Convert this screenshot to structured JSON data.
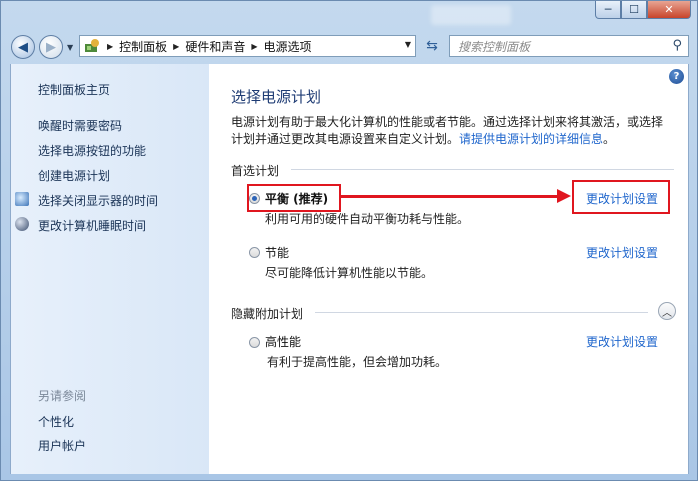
{
  "window": {
    "minimize": "─",
    "maximize": "☐",
    "close": "✕"
  },
  "navbar": {
    "breadcrumbs": [
      "控制面板",
      "硬件和声音",
      "电源选项"
    ],
    "search_placeholder": "搜索控制面板"
  },
  "sidebar": {
    "home": "控制面板主页",
    "links": [
      "唤醒时需要密码",
      "选择电源按钮的功能",
      "创建电源计划",
      "选择关闭显示器的时间",
      "更改计算机睡眠时间"
    ],
    "see_also_label": "另请参阅",
    "see_also": [
      "个性化",
      "用户帐户"
    ]
  },
  "main": {
    "title": "选择电源计划",
    "intro_text": "电源计划有助于最大化计算机的性能或者节能。通过选择计划来将其激活，或选择计划并通过更改其电源设置来自定义计划。",
    "intro_link": "请提供电源计划的详细信息",
    "intro_end": "。",
    "preferred_label": "首选计划",
    "hidden_label": "隐藏附加计划",
    "plans": [
      {
        "name": "平衡 (推荐)",
        "desc": "利用可用的硬件自动平衡功耗与性能。",
        "selected": true,
        "change": "更改计划设置"
      },
      {
        "name": "节能",
        "desc": "尽可能降低计算机性能以节能。",
        "selected": false,
        "change": "更改计划设置"
      },
      {
        "name": "高性能",
        "desc": "有利于提高性能，但会增加功耗。",
        "selected": false,
        "change": "更改计划设置"
      }
    ]
  },
  "colors": {
    "annotation": "#e0161f",
    "link": "#1f66cc"
  },
  "icons": [
    "back-arrow-icon",
    "forward-arrow-icon",
    "control-panel-icon",
    "refresh-icon",
    "search-icon",
    "help-icon",
    "monitor-icon",
    "moon-icon",
    "collapse-chevron-icon"
  ]
}
